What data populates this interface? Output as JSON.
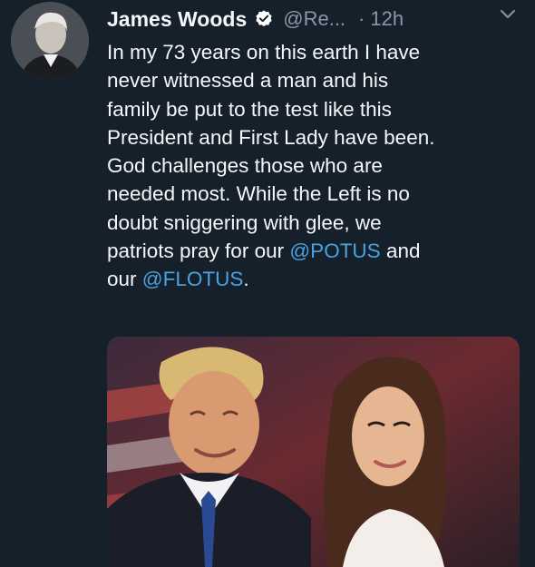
{
  "tweet": {
    "display_name": "James Woods",
    "handle": "@Re...",
    "separator": "·",
    "time": "12h",
    "text_lines": [
      "In my 73 years on this earth I have",
      "never witnessed a man and his",
      "family be put to the test like this",
      "President and First Lady have been.",
      "God challenges those who are",
      "needed most. While the Left is no",
      "doubt sniggering with glee, we"
    ],
    "line8_pre": "patriots pray for our ",
    "mention_1": "@POTUS",
    "line8_post": " and",
    "line9_pre": "our ",
    "mention_2": "@FLOTUS",
    "line9_post": "."
  },
  "icons": {
    "verified": "verified-badge-icon",
    "caret": "chevron-down-icon"
  },
  "colors": {
    "background": "#15202b",
    "text": "#f5f8fa",
    "secondary": "#8899a6",
    "link": "#4aa3df"
  }
}
